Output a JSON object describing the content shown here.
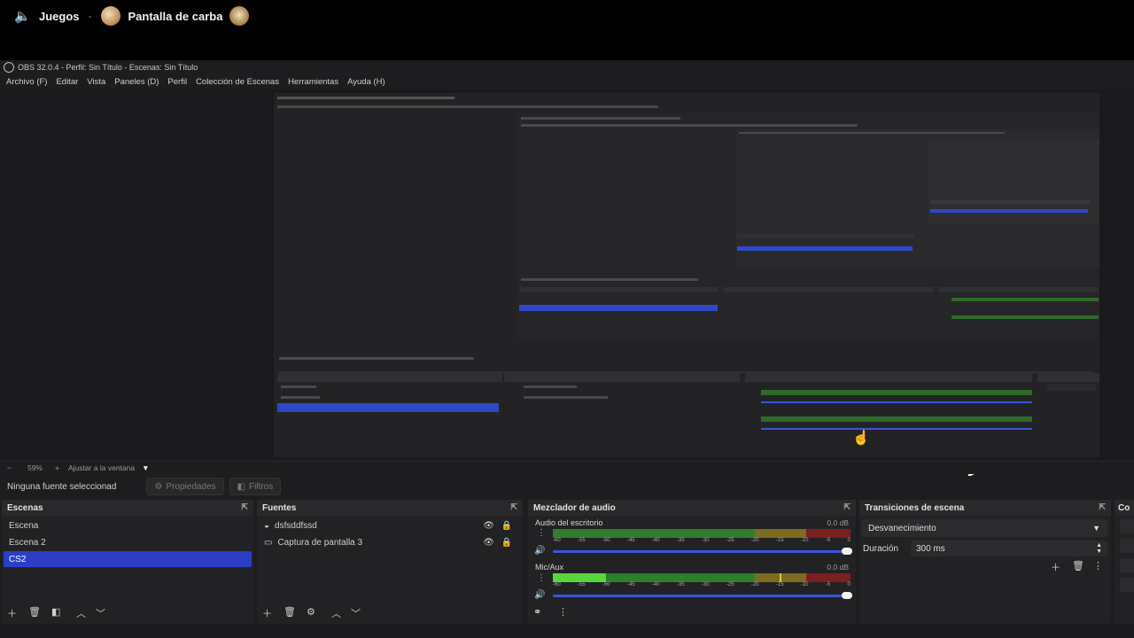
{
  "callbar": {
    "channel": "Juegos",
    "separator": "-",
    "user": "Pantalla de carba"
  },
  "obs": {
    "title": "OBS 32.0.4 - Perfil: Sin Título - Escenas: Sin Título",
    "menu": [
      "Archivo (F)",
      "Editar",
      "Vista",
      "Paneles (D)",
      "Perfil",
      "Colección de Escenas",
      "Herramientas",
      "Ayuda (H)"
    ],
    "zoom": {
      "minus": "−",
      "value": "59%",
      "plus": "+",
      "fit": "Ajustar a la ventana",
      "chevron": "▼"
    },
    "context": {
      "no_source": "Ninguna fuente seleccionad",
      "properties": "Propiedades",
      "filters": "Filtros"
    },
    "scenes": {
      "title": "Escenas",
      "items": [
        "Escena",
        "Escena 2",
        "CS2"
      ],
      "selected_index": 2
    },
    "sources": {
      "title": "Fuentes",
      "items": [
        "dsfsddfssd",
        "Captura de pantalla 3"
      ]
    },
    "mixer": {
      "title": "Mezclador de audio",
      "channels": [
        {
          "name": "Audio del escritorio",
          "db": "0.0 dB",
          "level": 0.0
        },
        {
          "name": "Mic/Aux",
          "db": "0.0 dB",
          "level": 0.18
        }
      ],
      "ticks": [
        "-60",
        "-55",
        "-50",
        "-45",
        "-40",
        "-35",
        "-30",
        "-25",
        "-20",
        "-15",
        "-10",
        "-5",
        "0"
      ]
    },
    "transitions": {
      "title": "Transiciones de escena",
      "selected": "Desvanecimiento",
      "duration_label": "Duración",
      "duration_value": "300 ms"
    },
    "controls_partial": "Co"
  },
  "colors": {
    "selection": "#2a3ec7",
    "meter_green": "#2f7e2a",
    "meter_yellow": "#7b6c1f",
    "meter_red": "#7b1f1f",
    "slider": "#3a55d6"
  }
}
